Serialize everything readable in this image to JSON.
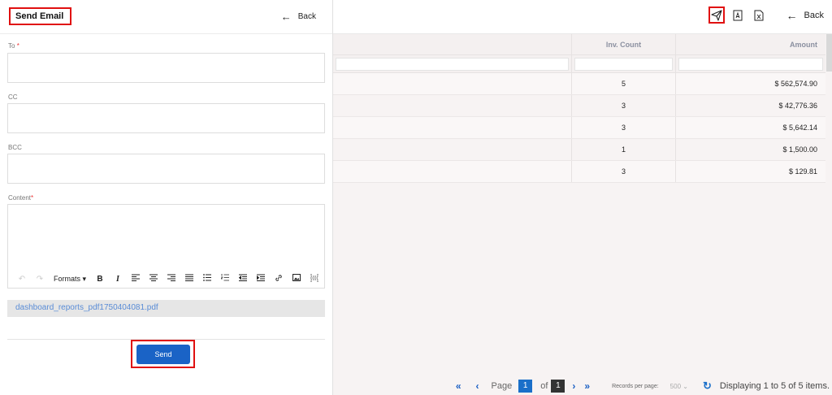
{
  "email_panel": {
    "title": "Send Email",
    "back_label": "Back",
    "to_label": "To",
    "to_required": "*",
    "cc_label": "CC",
    "bcc_label": "BCC",
    "content_label": "Content",
    "content_required": "*",
    "toolbar": {
      "formats_label": "Formats"
    },
    "attachment": "dashboard_reports_pdf1750404081.pdf",
    "send_label": "Send"
  },
  "background": {
    "back_label": "Back",
    "table": {
      "columns": [
        "Inv. Count",
        "Amount"
      ],
      "rows": [
        {
          "count": "5",
          "amount": "$ 562,574.90"
        },
        {
          "count": "3",
          "amount": "$ 42,776.36"
        },
        {
          "count": "3",
          "amount": "$ 5,642.14"
        },
        {
          "count": "1",
          "amount": "$ 1,500.00"
        },
        {
          "count": "3",
          "amount": "$ 129.81"
        }
      ]
    },
    "pager": {
      "page_label": "Page",
      "current_page": "1",
      "of_label": "of",
      "total_pages": "1",
      "records_per_page_label": "Records per page:",
      "records_per_page_value": "500",
      "display_text": "Displaying 1 to 5 of 5 items."
    }
  }
}
